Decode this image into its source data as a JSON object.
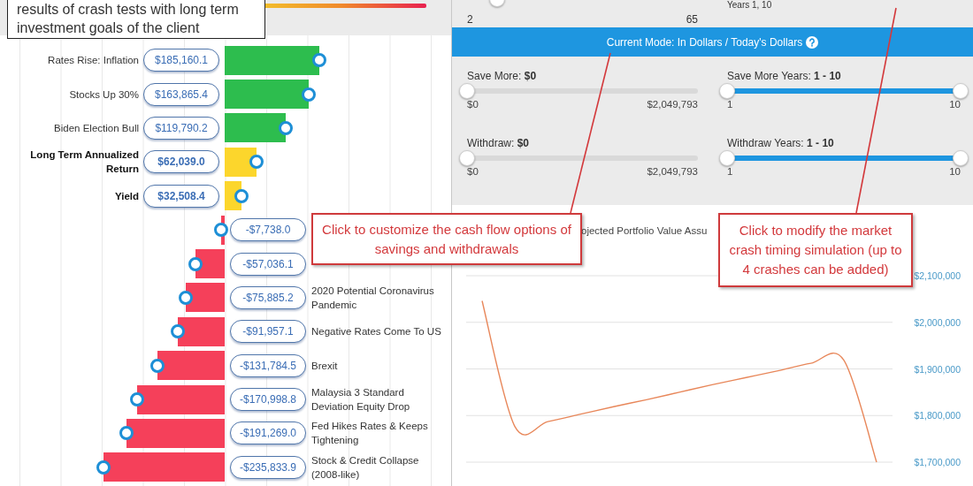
{
  "crash_tests": {
    "rows": [
      {
        "label": "Rates Rise: Inflation",
        "amount": "$185,160.1",
        "kind": "positive",
        "color": "#2dbd4e",
        "bold": false
      },
      {
        "label": "Stocks Up 30%",
        "amount": "$163,865.4",
        "kind": "positive",
        "color": "#2dbd4e",
        "bold": false
      },
      {
        "label": "Biden Election Bull",
        "amount": "$119,790.2",
        "kind": "positive",
        "color": "#2dbd4e",
        "bold": false
      },
      {
        "label": "Long Term Annualized Return",
        "amount": "$62,039.0",
        "kind": "positive",
        "color": "#fcd62c",
        "bold": true
      },
      {
        "label": "Yield",
        "amount": "$32,508.4",
        "kind": "positive",
        "color": "#fcd62c",
        "bold": true
      },
      {
        "amount": "-$7,738.0",
        "kind": "negative",
        "color": "#f5405a",
        "bold": false
      },
      {
        "amount": "-$57,036.1",
        "kind": "negative",
        "color": "#f5405a",
        "bold": false
      },
      {
        "label": "2020 Potential Coronavirus Pandemic",
        "amount": "-$75,885.2",
        "kind": "negative",
        "color": "#f5405a",
        "bold": false
      },
      {
        "label": "Negative Rates Come To US",
        "amount": "-$91,957.1",
        "kind": "negative",
        "color": "#f5405a",
        "bold": false
      },
      {
        "label": "Brexit",
        "amount": "-$131,784.5",
        "kind": "negative",
        "color": "#f5405a",
        "bold": false
      },
      {
        "label": "Malaysia 3 Standard Deviation Equity Drop",
        "amount": "-$170,998.8",
        "kind": "negative",
        "color": "#f5405a",
        "bold": false
      },
      {
        "label": "Fed Hikes Rates & Keeps Tightening",
        "amount": "-$191,269.0",
        "kind": "negative",
        "color": "#f5405a",
        "bold": false
      },
      {
        "label": "Stock & Credit Collapse (2008-like)",
        "amount": "-$235,833.9",
        "kind": "negative",
        "color": "#f5405a",
        "bold": false
      }
    ]
  },
  "planner": {
    "top_slider": {
      "min": "2",
      "max": "65",
      "level": 0.13
    },
    "years_label": "Years 1, 10",
    "mode_text": "Current Mode: In Dollars / Today's Dollars",
    "sliders": [
      {
        "label": "Save More:",
        "value": "$0",
        "min": "$0",
        "max": "$2,049,793",
        "kind": "single",
        "level": 0
      },
      {
        "label": "Save More Years:",
        "value": "1 - 10",
        "min": "1",
        "max": "10",
        "kind": "range",
        "level": 1
      },
      {
        "label": "Withdraw:",
        "value": "$0",
        "min": "$0",
        "max": "$2,049,793",
        "kind": "single",
        "level": 0
      },
      {
        "label": "Withdraw Years:",
        "value": "1 - 10",
        "min": "1",
        "max": "10",
        "kind": "range",
        "level": 1
      }
    ],
    "chart_title": "ojected Portfolio Value Assu",
    "chart_data": {
      "type": "line",
      "grid": true,
      "ylim": [
        1700000,
        2100000
      ],
      "yticks": [
        {
          "value": 2100000,
          "label": "$2,100,000"
        },
        {
          "value": 2000000,
          "label": "$2,000,000"
        },
        {
          "value": 1900000,
          "label": "$1,900,000"
        },
        {
          "value": 1800000,
          "label": "$1,800,000"
        },
        {
          "value": 1700000,
          "label": "$1,700,000"
        }
      ],
      "series": [
        {
          "color": "#e8875a",
          "values": [
            2046000,
            1776000,
            1787000,
            1803000,
            1819000,
            1834000,
            1850000,
            1866000,
            1881000,
            1896000,
            1912000,
            1919000,
            1700000
          ]
        }
      ]
    }
  },
  "callouts": [
    {
      "kind": "note",
      "text": "results of crash tests with long term investment goals of the client"
    },
    {
      "kind": "red",
      "text": "Click to customize the cash flow options of savings and withdrawals"
    },
    {
      "kind": "red",
      "text": "Click to modify the market crash timing simulation (up to 4 crashes can be added)"
    }
  ]
}
